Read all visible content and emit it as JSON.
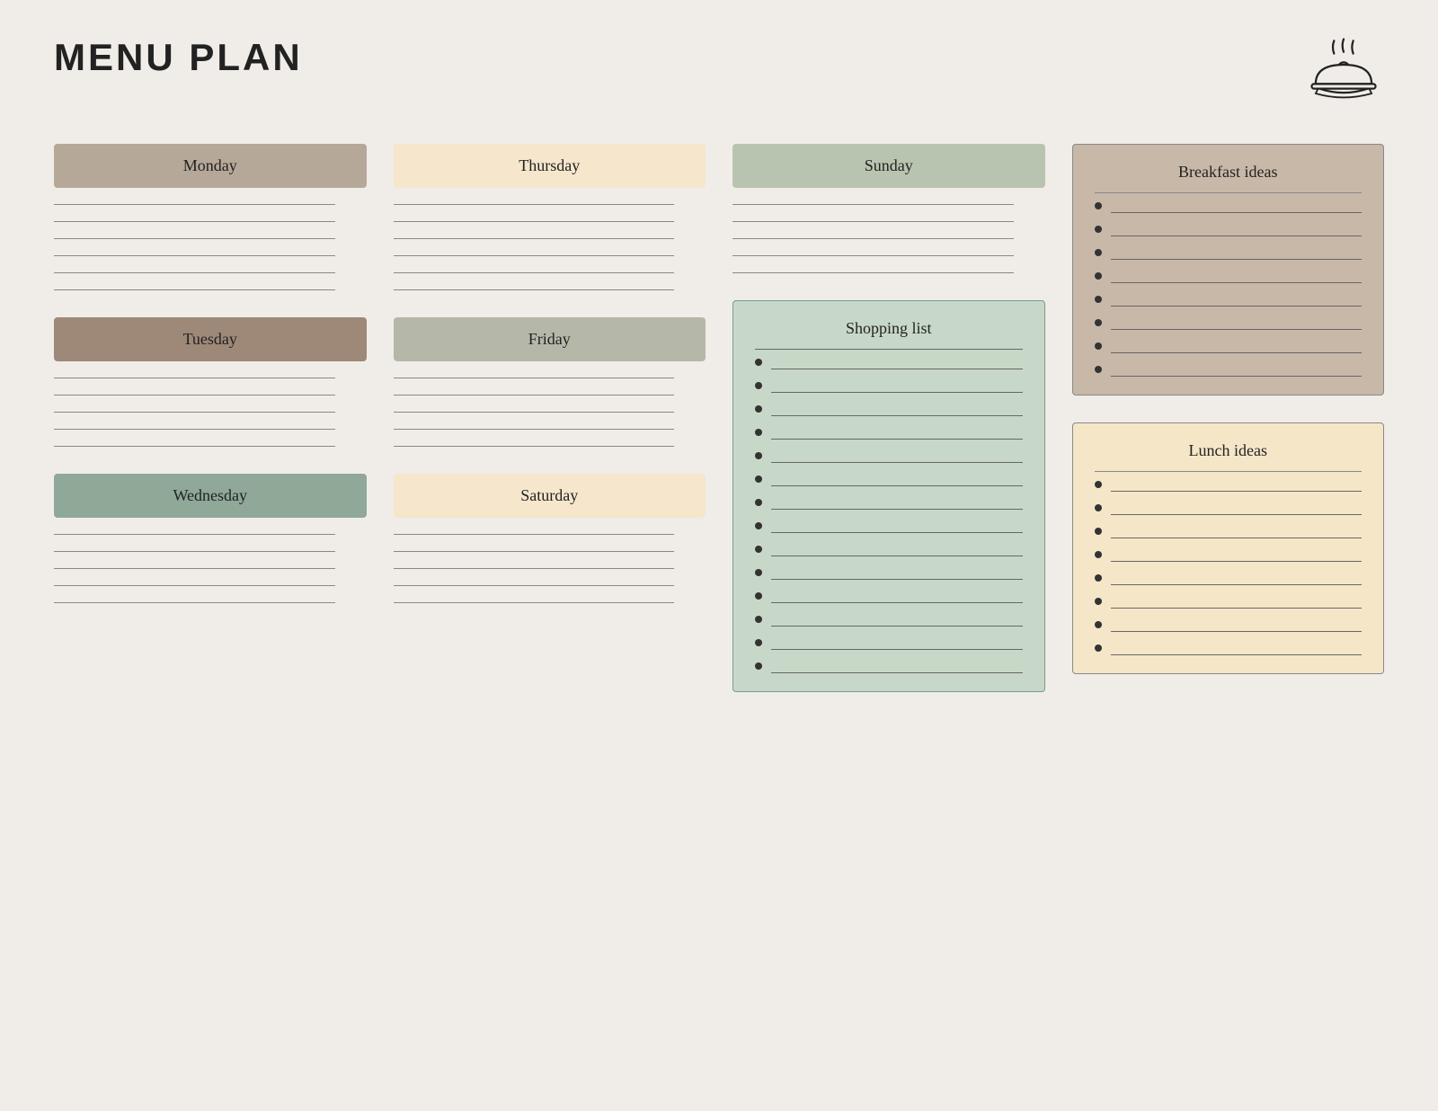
{
  "title": "MENU PLAN",
  "days": {
    "monday": {
      "label": "Monday",
      "color_class": "monday-bg",
      "lines": 6
    },
    "tuesday": {
      "label": "Tuesday",
      "color_class": "tuesday-bg",
      "lines": 5
    },
    "wednesday": {
      "label": "Wednesday",
      "color_class": "wednesday-bg",
      "lines": 5
    },
    "thursday": {
      "label": "Thursday",
      "color_class": "thursday-bg",
      "lines": 6
    },
    "friday": {
      "label": "Friday",
      "color_class": "friday-bg",
      "lines": 5
    },
    "saturday": {
      "label": "Saturday",
      "color_class": "saturday-bg",
      "lines": 5
    },
    "sunday": {
      "label": "Sunday",
      "color_class": "sunday-bg",
      "lines": 5
    }
  },
  "shopping_list": {
    "title": "Shopping list",
    "items": 14
  },
  "breakfast_ideas": {
    "title": "Breakfast ideas",
    "items": 8
  },
  "lunch_ideas": {
    "title": "Lunch ideas",
    "items": 8
  }
}
